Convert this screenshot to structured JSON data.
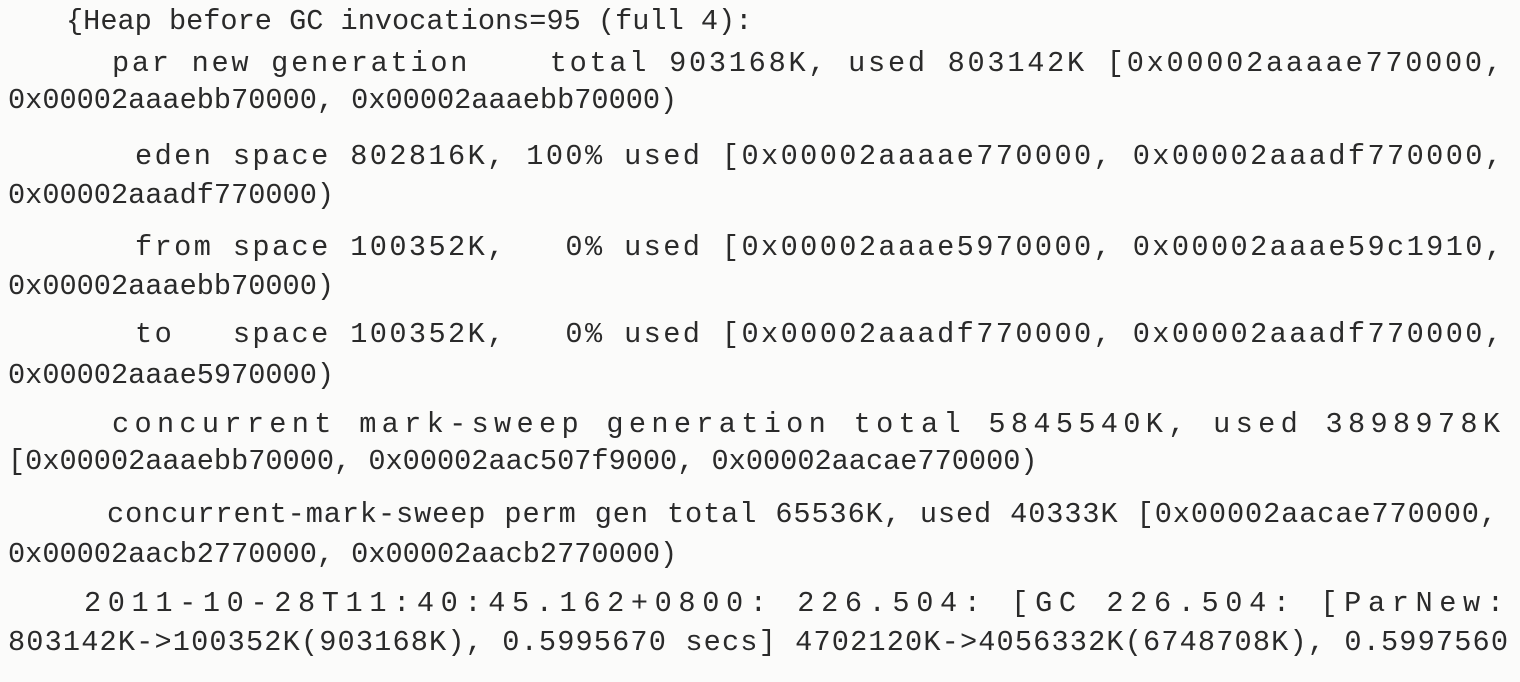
{
  "document": {
    "type": "gc-log-excerpt",
    "lines": [
      {
        "id": "heap-header",
        "text": "{Heap before GC invocations=95 (full 4):"
      },
      {
        "id": "par-new-generation",
        "text": "par new generation    total 903168K, used 803142K [0x00002aaaae770000,"
      },
      {
        "id": "par-new-generation-cont",
        "text": "0x00002aaaebb70000, 0x00002aaaebb70000)"
      },
      {
        "id": "eden-space",
        "text": "eden space 802816K, 100% used [0x00002aaaae770000, 0x00002aaadf770000,"
      },
      {
        "id": "eden-space-cont",
        "text": "0x00002aaadf770000)"
      },
      {
        "id": "from-space",
        "text": "from space 100352K,   0% used [0x00002aaae5970000, 0x00002aaae59c1910,"
      },
      {
        "id": "from-space-cont",
        "text": "0x00002aaaebb70000)"
      },
      {
        "id": "to-space",
        "text": "to   space 100352K,   0% used [0x00002aaadf770000, 0x00002aaadf770000,"
      },
      {
        "id": "to-space-cont",
        "text": "0x00002aaae5970000)"
      },
      {
        "id": "cms-generation",
        "text": "concurrent mark-sweep generation total 5845540K, used 3898978K"
      },
      {
        "id": "cms-generation-cont",
        "text": "[0x00002aaaebb70000, 0x00002aac507f9000, 0x00002aacae770000)"
      },
      {
        "id": "cms-perm-gen",
        "text": "concurrent-mark-sweep perm gen total 65536K, used 40333K [0x00002aacae770000,"
      },
      {
        "id": "cms-perm-gen-cont",
        "text": "0x00002aacb2770000, 0x00002aacb2770000)"
      },
      {
        "id": "gc-event",
        "text": "2011-10-28T11:40:45.162+0800: 226.504: [GC 226.504: [ParNew:"
      },
      {
        "id": "gc-event-cont",
        "text": "803142K->100352K(903168K), 0.5995670 secs] 4702120K->4056332K(6748708K), 0.5997560"
      }
    ]
  }
}
